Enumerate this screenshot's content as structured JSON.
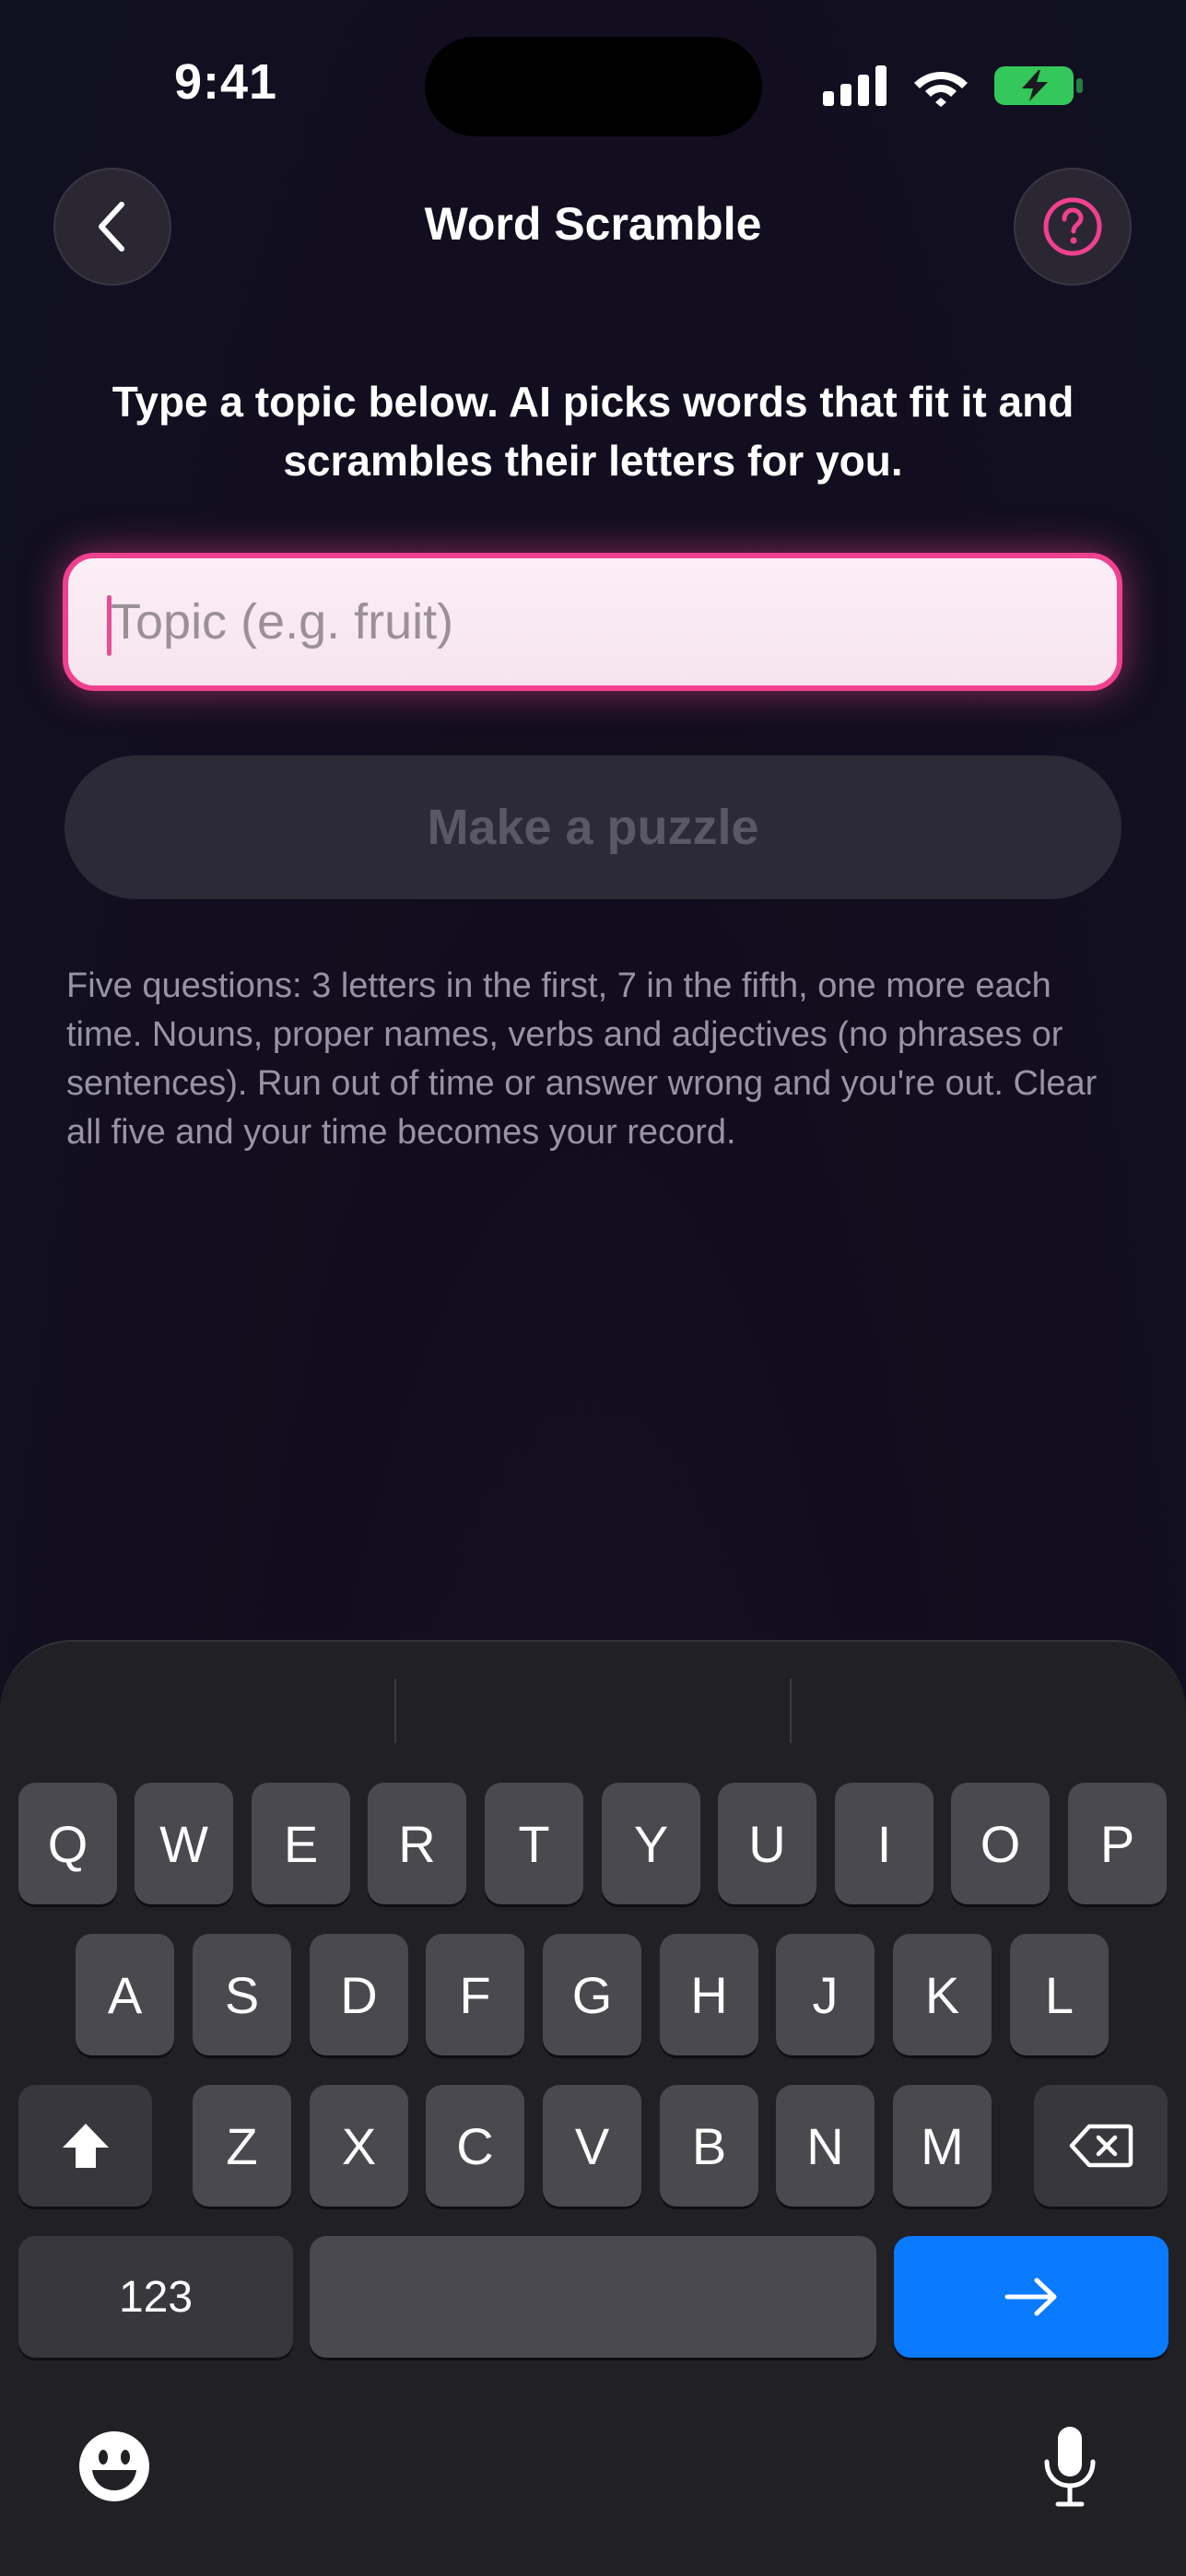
{
  "status_bar": {
    "time": "9:41"
  },
  "header": {
    "title": "Word Scramble",
    "back_icon": "chevron-left-icon",
    "help_icon": "question-circle-icon"
  },
  "intro": "Type a topic below. AI picks words that fit it and scrambles their letters for you.",
  "topic_input": {
    "placeholder": "Topic (e.g. fruit)",
    "value": ""
  },
  "make_puzzle_label": "Make a puzzle",
  "rules": "Five questions: 3 letters in the first, 7 in the fifth, one more each time. Nouns, proper names, verbs and adjectives (no phrases or sentences). Run out of time or answer wrong and you're out. Clear all five and your time becomes your record.",
  "keyboard": {
    "row1": [
      "Q",
      "W",
      "E",
      "R",
      "T",
      "Y",
      "U",
      "I",
      "O",
      "P"
    ],
    "row2": [
      "A",
      "S",
      "D",
      "F",
      "G",
      "H",
      "J",
      "K",
      "L"
    ],
    "row3": [
      "Z",
      "X",
      "C",
      "V",
      "B",
      "N",
      "M"
    ],
    "numbers_label": "123",
    "icons": {
      "shift": "shift-icon",
      "delete": "backspace-icon",
      "go": "arrow-right-icon",
      "emoji": "emoji-icon",
      "dictation": "microphone-icon"
    }
  },
  "colors": {
    "accent_pink": "#f0418f",
    "keyboard_bg": "#212024",
    "key_bg": "#4a494f",
    "go_key_blue": "#0a7aff"
  }
}
